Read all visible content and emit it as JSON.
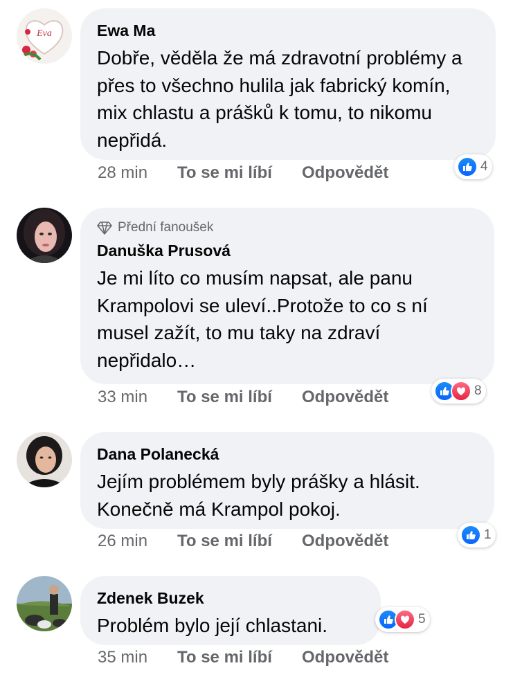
{
  "comments": [
    {
      "name": "Ewa Ma",
      "fan_badge": "",
      "text": "Dobře, věděla že má zdravotní problémy a přes to všechno hulila jak fabrický komín, mix chlastu a prášků k tomu, to nikomu nepřidá.",
      "time": "28 min",
      "like_label": "To se mi líbí",
      "reply_label": "Odpovědět",
      "reaction_count": "4",
      "reactions": [
        "like"
      ]
    },
    {
      "name": "Danuška Prusová",
      "fan_badge": "Přední fanoušek",
      "text": "Je mi líto co musím napsat, ale panu Krampolovi se uleví..Protože to co s ní musel zažít, to mu taky na zdraví nepřidalo…",
      "time": "33 min",
      "like_label": "To se mi líbí",
      "reply_label": "Odpovědět",
      "reaction_count": "8",
      "reactions": [
        "like",
        "love"
      ]
    },
    {
      "name": "Dana Polanecká",
      "fan_badge": "",
      "text": "Jejím problémem byly prášky a  hlásit. Konečně má Krampol pokoj.",
      "time": "26 min",
      "like_label": "To se mi líbí",
      "reply_label": "Odpovědět",
      "reaction_count": "1",
      "reactions": [
        "like"
      ]
    },
    {
      "name": "Zdenek Buzek",
      "fan_badge": "",
      "text": "Problém bylo její chlastani.",
      "time": "35 min",
      "like_label": "To se mi líbí",
      "reply_label": "Odpovědět",
      "reaction_count": "5",
      "reactions": [
        "like",
        "love"
      ]
    }
  ],
  "avatar_1_text": "Eva",
  "colors": {
    "bubble": "#f0f2f5",
    "meta": "#65676b",
    "like": "#0866ff",
    "love": "#e42645"
  }
}
